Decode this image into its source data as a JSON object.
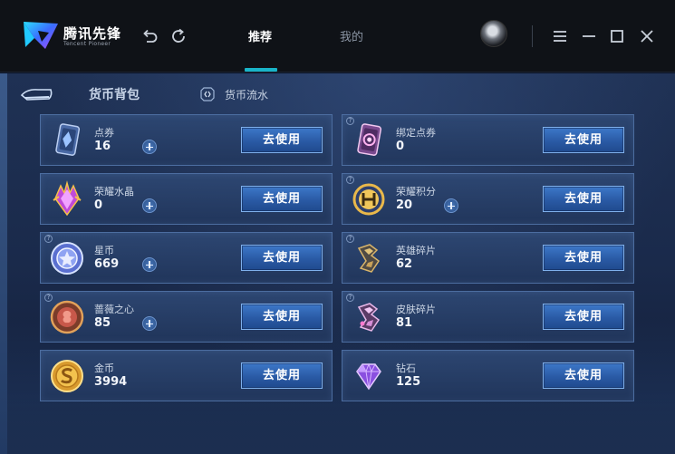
{
  "app": {
    "brand_name": "腾讯先锋",
    "brand_sub": "Tencent Pioneer"
  },
  "nav": {
    "tabs": [
      {
        "label": "推荐",
        "active": true
      },
      {
        "label": "我的",
        "active": false
      }
    ]
  },
  "toolbar": {
    "icons": [
      "undo-icon",
      "refresh-icon",
      "menu-icon",
      "minimize-icon",
      "maximize-icon",
      "close-icon"
    ]
  },
  "subnav": {
    "active_label": "货币背包",
    "flow_label": "货币流水"
  },
  "cards": [
    {
      "name": "点券",
      "amount": "16",
      "plus": true,
      "button": "去使用",
      "help": false,
      "icon": "coupon-icon"
    },
    {
      "name": "绑定点券",
      "amount": "0",
      "plus": false,
      "button": "去使用",
      "help": true,
      "icon": "bound-coupon-icon"
    },
    {
      "name": "荣耀水晶",
      "amount": "0",
      "plus": true,
      "button": "去使用",
      "help": false,
      "icon": "glory-crystal-icon"
    },
    {
      "name": "荣耀积分",
      "amount": "20",
      "plus": true,
      "button": "去使用",
      "help": true,
      "icon": "glory-points-icon"
    },
    {
      "name": "星币",
      "amount": "669",
      "plus": true,
      "button": "去使用",
      "help": true,
      "icon": "star-coin-icon"
    },
    {
      "name": "英雄碎片",
      "amount": "62",
      "plus": false,
      "button": "去使用",
      "help": true,
      "icon": "hero-fragment-icon"
    },
    {
      "name": "蔷薇之心",
      "amount": "85",
      "plus": true,
      "button": "去使用",
      "help": true,
      "icon": "rose-heart-icon"
    },
    {
      "name": "皮肤碎片",
      "amount": "81",
      "plus": false,
      "button": "去使用",
      "help": true,
      "icon": "skin-fragment-icon"
    },
    {
      "name": "金币",
      "amount": "3994",
      "plus": false,
      "button": "去使用",
      "help": false,
      "icon": "gold-coin-icon"
    },
    {
      "name": "钻石",
      "amount": "125",
      "plus": false,
      "button": "去使用",
      "help": false,
      "icon": "diamond-icon"
    }
  ],
  "colors": {
    "accent": "#19b4c8",
    "button": "#2a5aa5",
    "card_border": "#4c6da0"
  }
}
